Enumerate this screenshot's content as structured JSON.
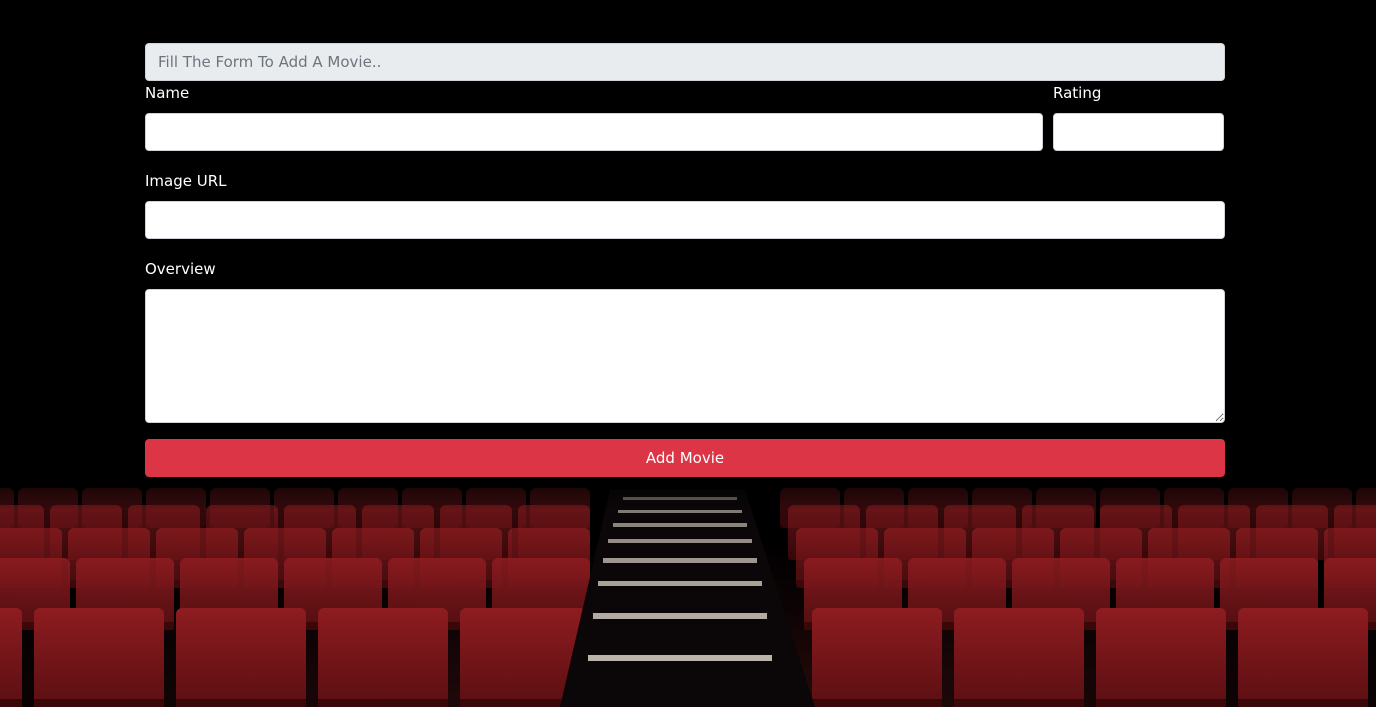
{
  "form": {
    "banner_text": "Fill The Form To Add A Movie..",
    "fields": {
      "name": {
        "label": "Name",
        "value": ""
      },
      "rating": {
        "label": "Rating",
        "value": ""
      },
      "image_url": {
        "label": "Image URL",
        "value": ""
      },
      "overview": {
        "label": "Overview",
        "value": ""
      }
    },
    "submit_label": "Add Movie"
  },
  "colors": {
    "page_background": "#000000",
    "accent_button": "#dc3545",
    "banner_background": "#e9ecef",
    "seat_red": "#7a1518"
  },
  "background_image": "cinema-theater-seats"
}
